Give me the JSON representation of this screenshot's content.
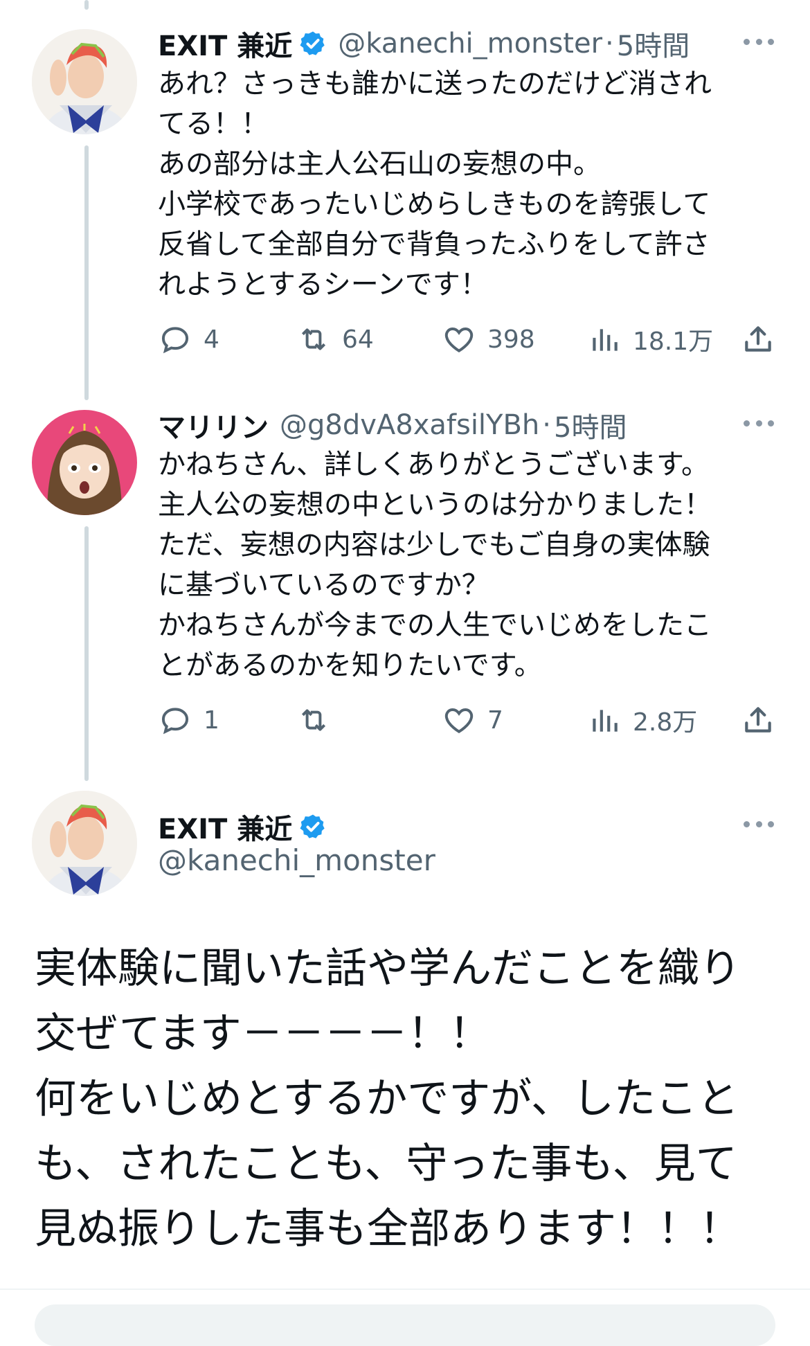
{
  "tweets": [
    {
      "name": "EXIT 兼近",
      "handle": "@kanechi_monster",
      "dot": "·",
      "time": "5時間",
      "text": "あれ？さっきも誰かに送ったのだけど消され\nてる！！\nあの部分は主人公石山の妄想の中。\n小学校であったいじめらしきものを誇張して\n反省して全部自分で背負ったふりをして許さ\nれようとするシーンです！",
      "replies": "4",
      "retweets": "64",
      "likes": "398",
      "views": "18.1万"
    },
    {
      "name": "マリリン",
      "handle": "@g8dvA8xafsilYBh",
      "dot": "·",
      "time": "5時間",
      "text": "かねちさん、詳しくありがとうございます。\n主人公の妄想の中というのは分かりました！\nただ、妄想の内容は少しでもご自身の実体験\nに基づいているのですか？\nかねちさんが今までの人生でいじめをしたこ\nとがあるのかを知りたいです。",
      "replies": "1",
      "retweets": "",
      "likes": "7",
      "views": "2.8万"
    }
  ],
  "main_tweet": {
    "name": "EXIT 兼近",
    "handle": "@kanechi_monster",
    "text": "実体験に聞いた話や学んだことを織り\n交ぜてます－－－－！！\n何をいじめとするかですが、したこと\nも、されたことも、守った事も、見て\n見ぬ振りした事も全部あります！！！"
  },
  "colors": {
    "verified": "#1d9bf0",
    "secondary_text": "#536471",
    "thread_line": "#cfd9de"
  },
  "icons": [
    "reply-icon",
    "retweet-icon",
    "like-icon",
    "views-icon",
    "share-icon",
    "verified-badge-icon",
    "more-icon"
  ]
}
